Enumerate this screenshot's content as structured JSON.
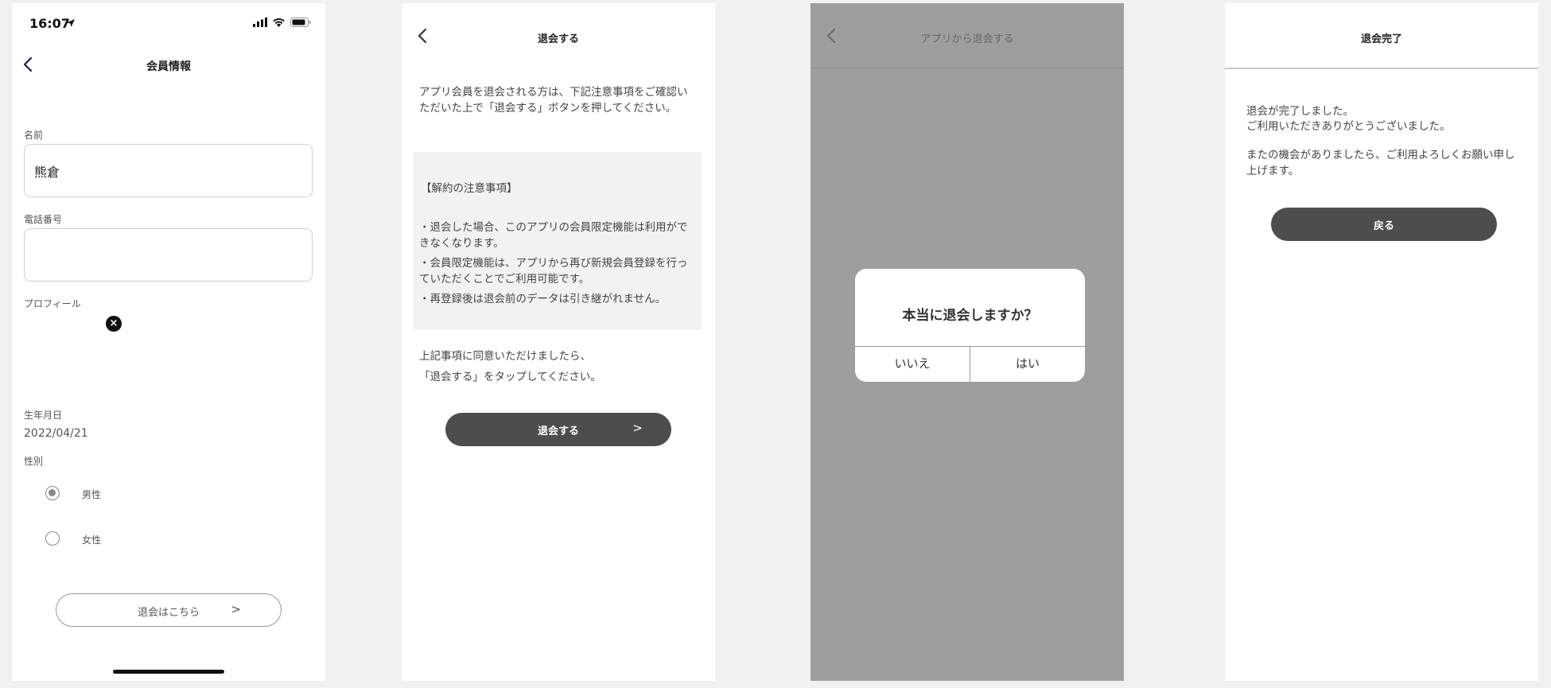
{
  "screen1": {
    "status_time": "16:07",
    "title": "会員情報",
    "name_label": "名前",
    "name_value": "熊倉",
    "phone_label": "電話番号",
    "phone_value": "",
    "profile_label": "プロフィール",
    "birthdate_label": "生年月日",
    "birthdate_value": "2022/04/21",
    "gender_label": "性別",
    "gender_options": [
      "男性",
      "女性"
    ],
    "gender_selected": "男性",
    "withdraw_button": "退会はこちら",
    "withdraw_arrow": ">"
  },
  "screen2": {
    "title": "退会する",
    "intro": "アプリ会員を退会される方は、下記注意事項をご確認いただいた上で「退会する」ボタンを押してください。",
    "notice_title": "【解約の注意事項】",
    "notice_items": [
      "・退会した場合、このアプリの会員限定機能は利用ができなくなります。",
      "・会員限定機能は、アプリから再び新規会員登録を行っていただくことでご利用可能です。",
      "・再登録後は退会前のデータは引き継がれません。"
    ],
    "outro_line1": "上記事項に同意いただけましたら、",
    "outro_line2": "「退会する」をタップしてください。",
    "button": "退会する",
    "button_arrow": ">"
  },
  "screen3": {
    "title": "アプリから退会する",
    "dialog_message": "本当に退会しますか？",
    "no_button": "いいえ",
    "yes_button": "はい"
  },
  "screen4": {
    "title": "退会完了",
    "message_line1": "退会が完了しました。",
    "message_line2": "ご利用いただきありがとうございました。",
    "message_line3": "またの機会がありましたら、ご利用よろしくお願い申し上げます。",
    "back_button": "戻る"
  },
  "colors": {
    "page_background": "#f1f1f1",
    "dark_button": "#4d4d4d",
    "overlay": "#9e9e9e"
  }
}
